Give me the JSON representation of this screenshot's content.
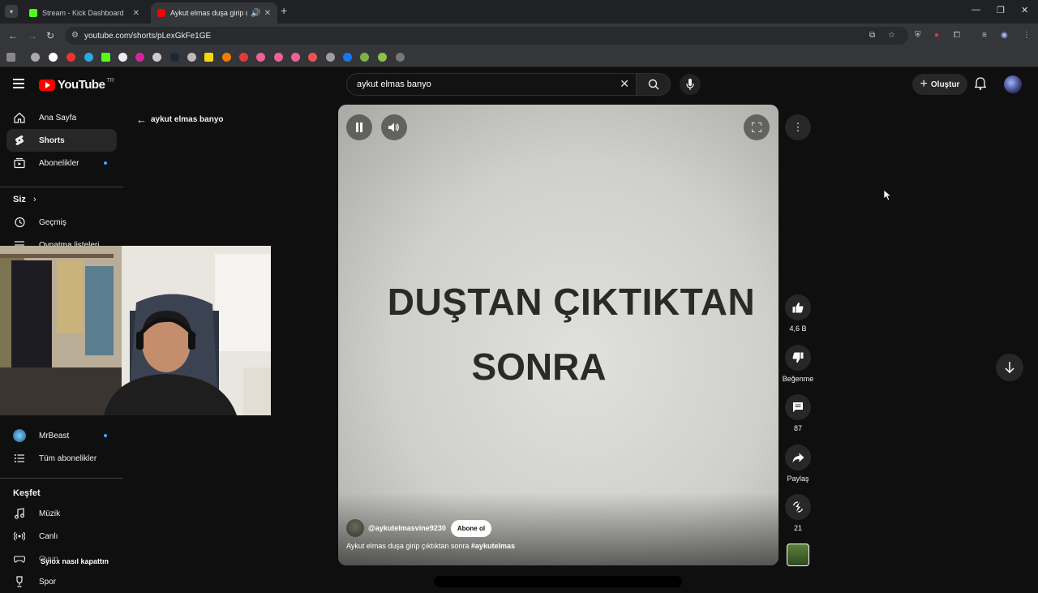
{
  "browser": {
    "tabs": [
      {
        "title": "Stream - Kick Dashboard",
        "favicon_color": "#53fc18"
      },
      {
        "title": "Aykut elmas duşa girip çıktıktan sonra",
        "favicon_color": "#ff0000"
      }
    ],
    "url": "youtube.com/shorts/pLexGkFe1GE"
  },
  "header": {
    "logo_text": "YouTube",
    "region": "TR",
    "search_value": "aykut elmas banyo",
    "create_label": "Oluştur"
  },
  "sidebar": {
    "main": [
      {
        "label": "Ana Sayfa"
      },
      {
        "label": "Shorts"
      },
      {
        "label": "Abonelikler"
      }
    ],
    "you_heading": "Siz",
    "you_items": [
      {
        "label": "Geçmiş"
      },
      {
        "label": "Oynatma listeleri"
      }
    ],
    "subs": [
      {
        "label": "MrBeast"
      },
      {
        "label": "Tüm abonelikler"
      }
    ],
    "explore_heading": "Keşfet",
    "explore_items": [
      {
        "label": "Müzik"
      },
      {
        "label": "Canlı"
      },
      {
        "label": "Oyun"
      },
      {
        "label": "Spor"
      }
    ]
  },
  "back_label": "aykut elmas banyo",
  "stream_overlay_text": "Syiox nasıl kapattın",
  "video": {
    "line1": "DUŞTAN ÇIKTIKTAN",
    "line2": "SONRA",
    "channel": "@aykutelmasvine9230",
    "subscribe_label": "Abone ol",
    "title": "Aykut elmas duşa girip çıktıktan sonra",
    "hashtag": "#aykutelmas"
  },
  "actions": {
    "likes": "4,6 B",
    "dislike_label": "Beğenme",
    "comments": "87",
    "share_label": "Paylaş",
    "remix": "21"
  },
  "colors": {
    "yt_red": "#ff0000",
    "bg": "#0f0f0f",
    "accent_blue": "#3ea6ff"
  }
}
